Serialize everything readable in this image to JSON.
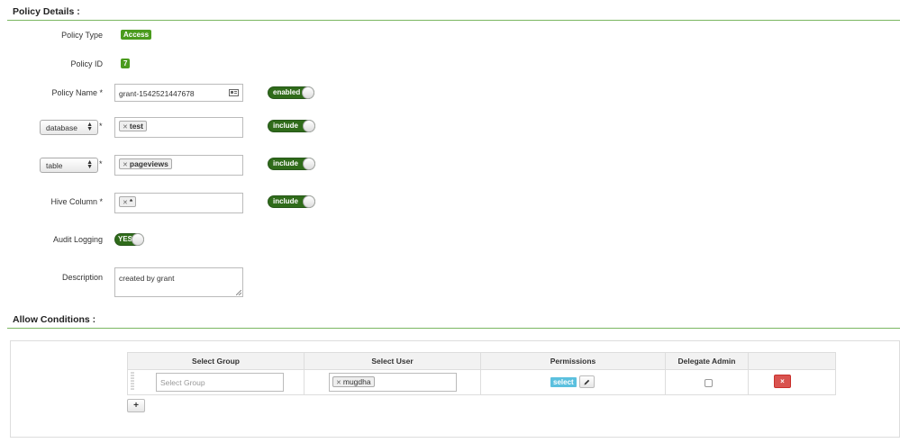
{
  "policy_details": {
    "title": "Policy Details :",
    "policy_type": {
      "label": "Policy Type",
      "value": "Access"
    },
    "policy_id": {
      "label": "Policy ID",
      "value": "7"
    },
    "policy_name": {
      "label": "Policy Name *",
      "value": "grant-1542521447678",
      "toggle": "enabled"
    },
    "database": {
      "selected": "database",
      "star": "*",
      "tag": "test",
      "toggle": "include"
    },
    "table": {
      "selected": "table",
      "star": "*",
      "tag": "pageviews",
      "toggle": "include"
    },
    "hive_column": {
      "label": "Hive Column *",
      "tag": "*",
      "toggle": "include"
    },
    "audit_logging": {
      "label": "Audit Logging",
      "toggle": "YES"
    },
    "description": {
      "label": "Description",
      "value": "created by grant"
    }
  },
  "allow_conditions": {
    "title": "Allow Conditions :",
    "columns": [
      "Select Group",
      "Select User",
      "Permissions",
      "Delegate Admin",
      ""
    ],
    "row": {
      "group_placeholder": "Select Group",
      "user_tag": "mugdha",
      "permission": "select",
      "delegate_admin": false
    },
    "add_label": "+",
    "remove_label": "×"
  },
  "colors": {
    "accent_green": "#4a9b1d",
    "toggle_green": "#2f6b1a",
    "danger": "#d9534f",
    "permission_blue": "#5bc0de"
  }
}
